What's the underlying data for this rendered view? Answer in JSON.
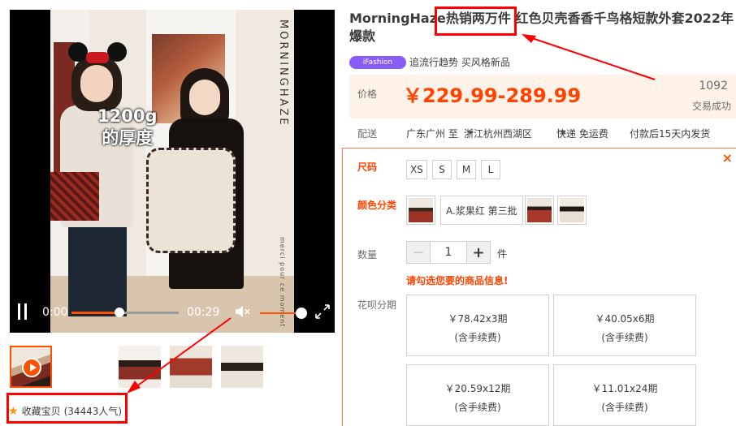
{
  "video": {
    "brand": "MORNINGHAZE",
    "tagline": "merci pour ce moment",
    "overlay_line1": "1200g",
    "overlay_line2": "的厚度",
    "time_current": "0:00",
    "time_total": "00:29",
    "progress": 0.45
  },
  "thumbnails": [
    {
      "label": "thumb-1"
    },
    {
      "label": "thumb-2"
    },
    {
      "label": "thumb-3"
    },
    {
      "label": "thumb-4"
    },
    {
      "label": "thumb-5"
    },
    {
      "label": "thumb-6"
    }
  ],
  "favorite": {
    "label": "收藏宝贝",
    "count": "(34443人气)"
  },
  "product": {
    "title": "MorningHaze热销两万件 红色贝壳香香千鸟格短款外套2022年爆款",
    "badge": "iFashion",
    "badge_text": "追流行趋势 买风格新品",
    "price_label": "价格",
    "price": "￥229.99-289.99",
    "sold_count": "1092",
    "sold_label": "交易成功"
  },
  "shipping": {
    "label": "配送",
    "from": "广东广州 至",
    "to": "浙江杭州西湖区",
    "method": "快递 免运费",
    "delivery": "付款后15天内发货"
  },
  "sku": {
    "size_label": "尺码",
    "sizes": [
      "XS",
      "S",
      "M",
      "L"
    ],
    "color_label": "颜色分类",
    "color_text": "A.浆果红 第三批",
    "qty_label": "数量",
    "qty_minus": "−",
    "qty_value": "1",
    "qty_plus": "+",
    "qty_unit": "件",
    "warning": "请勾选您要的商品信息!",
    "installment_label": "花呗分期",
    "installments": [
      {
        "amount": "￥78.42x3期",
        "fee": "(含手续费)"
      },
      {
        "amount": "￥40.05x6期",
        "fee": "(含手续费)"
      },
      {
        "amount": "￥20.59x12期",
        "fee": "(含手续费)"
      },
      {
        "amount": "￥11.01x24期",
        "fee": "(含手续费)"
      }
    ],
    "close": "×"
  },
  "colors": {
    "accent": "#ff4400",
    "annotation": "#ff0000",
    "badge": "#8a5cf6"
  }
}
